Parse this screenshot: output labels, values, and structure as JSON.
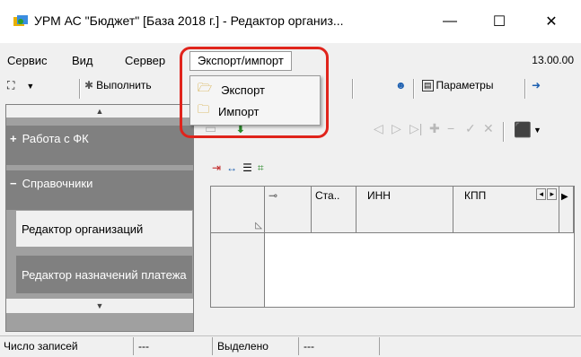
{
  "window": {
    "title": "УРМ АС \"Бюджет\" [База 2018 г.] - Редактор организ...",
    "minimize": "—",
    "maximize": "☐",
    "close": "✕"
  },
  "menu": {
    "items": [
      "Сервис",
      "Вид",
      "Сервер",
      "Экспорт/импорт"
    ],
    "version": "13.00.00"
  },
  "toolbar": {
    "run_label": "Выполнить",
    "params_label": "Параметры"
  },
  "dropdown": {
    "items": [
      "Экспорт",
      "Импорт"
    ]
  },
  "sidebar": {
    "groups": [
      {
        "sign": "+",
        "label": "Работа с ФК"
      },
      {
        "sign": "−",
        "label": "Справочники"
      }
    ],
    "links": [
      "Редактор организаций",
      "Редактор назначений платежа"
    ]
  },
  "grid": {
    "columns": [
      "Ста..",
      "ИНН",
      "КПП"
    ]
  },
  "status": {
    "records_label": "Число записей",
    "records_value": "---",
    "selected_label": "Выделено",
    "selected_value": "---"
  },
  "colors": {
    "highlight": "#e0241c"
  }
}
